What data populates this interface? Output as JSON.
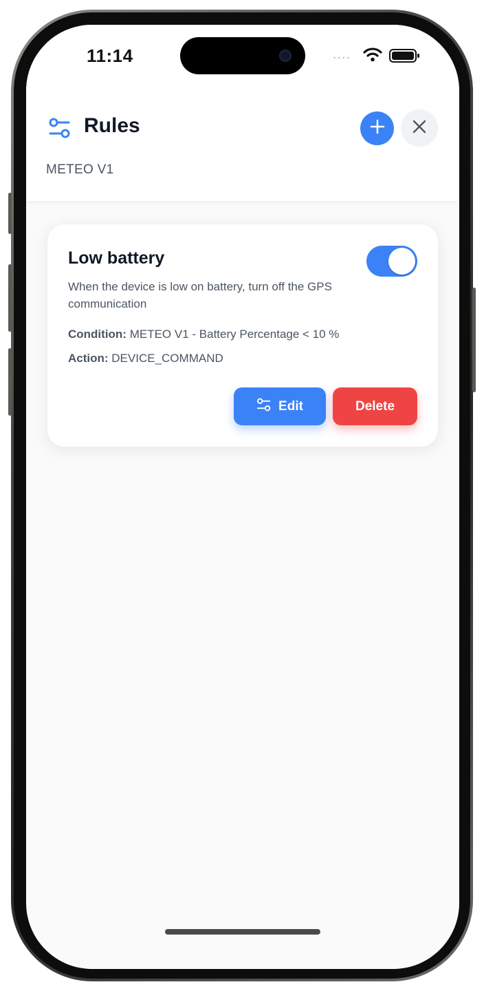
{
  "status_bar": {
    "time": "11:14",
    "signal_dots": "....",
    "icons": [
      "wifi-icon",
      "battery-icon"
    ]
  },
  "header": {
    "icon": "sliders-icon",
    "title": "Rules",
    "subtitle": "METEO V1",
    "add_icon": "plus-icon",
    "close_icon": "close-icon"
  },
  "rules": [
    {
      "title": "Low battery",
      "description": "When the device is low on battery, turn off the GPS communication",
      "condition_label": "Condition:",
      "condition_value": "METEO V1 - Battery Percentage < 10 %",
      "action_label": "Action:",
      "action_value": "DEVICE_COMMAND",
      "enabled": true,
      "edit_label": "Edit",
      "delete_label": "Delete"
    }
  ],
  "colors": {
    "accent": "#3b82f6",
    "danger": "#ef4444",
    "title_text": "#111827",
    "muted_text": "#4b5563"
  }
}
